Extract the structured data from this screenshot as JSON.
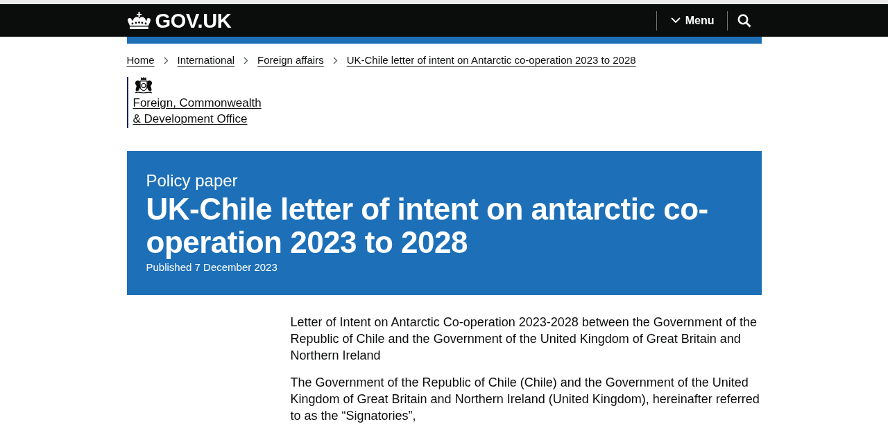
{
  "header": {
    "logo_text": "GOV.UK",
    "menu_button": "Menu"
  },
  "breadcrumbs": [
    {
      "label": "Home"
    },
    {
      "label": "International"
    },
    {
      "label": "Foreign affairs"
    },
    {
      "label": "UK-Chile letter of intent on Antarctic co-operation 2023 to 2028"
    }
  ],
  "organisation": {
    "lines": [
      "Foreign, Commonwealth",
      "& Development Office"
    ]
  },
  "title_banner": {
    "document_type": "Policy paper",
    "title": "UK-Chile letter of intent on antarctic co-operation 2023 to 2028",
    "published": "Published 7 December 2023"
  },
  "body": {
    "paragraphs": [
      "Letter of Intent on Antarctic Co-operation 2023-2028 between the Government of the Republic of Chile and the Government of the United Kingdom of Great Britain and Northern Ireland",
      "The Government of the Republic of Chile (Chile) and the Government of the United Kingdom of Great Britain and Northern Ireland (United Kingdom), hereinafter referred to as the “Signatories”,"
    ]
  }
}
